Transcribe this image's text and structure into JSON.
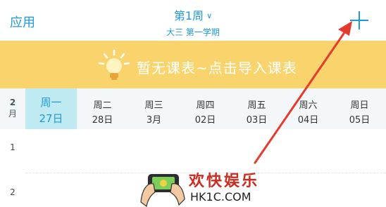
{
  "header": {
    "apps_label": "应用",
    "week_label": "第1周",
    "term_label": "大三  第一学期",
    "add_icon": "plus-icon"
  },
  "banner": {
    "text": "暂无课表~点击导入课表",
    "icon": "lightbulb-icon",
    "color": "#f9d36b"
  },
  "calendar": {
    "month_number": "2",
    "month_unit": "月",
    "days": [
      {
        "name": "周一",
        "date": "27日",
        "today": true
      },
      {
        "name": "周二",
        "date": "28日"
      },
      {
        "name": "周三",
        "date": "3月"
      },
      {
        "name": "周四",
        "date": "02日"
      },
      {
        "name": "周五",
        "date": "03日"
      },
      {
        "name": "周六",
        "date": "04日"
      },
      {
        "name": "周日",
        "date": "05日"
      }
    ],
    "periods": [
      "1",
      "2"
    ]
  },
  "watermark": {
    "title": "欢快娱乐",
    "url": "HK1C.COM"
  },
  "colors": {
    "accent": "#1e9bd7",
    "today_bg": "#bfeaf2",
    "arrow": "#e53a2c"
  }
}
